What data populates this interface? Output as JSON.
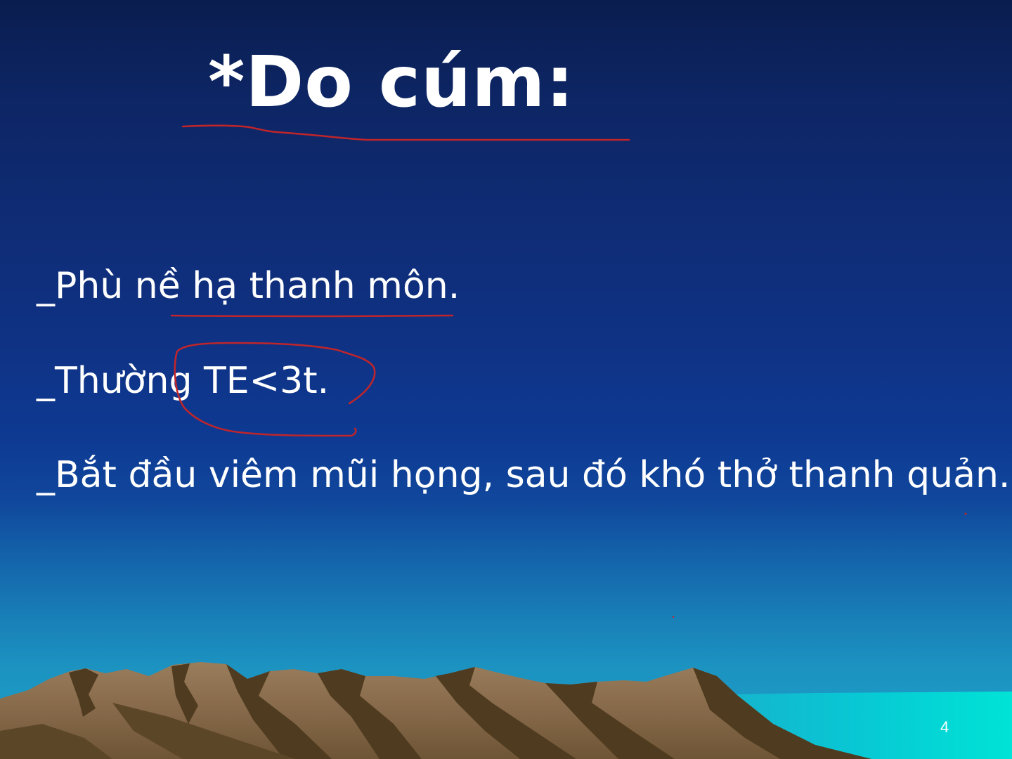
{
  "slide": {
    "title": "*Do cúm:",
    "bullets": [
      "_Phù nề hạ thanh môn.",
      "_Thường TE<3t.",
      "_Bắt đầu viêm mũi họng, sau đó khó thở thanh quản."
    ],
    "page_number": "4"
  },
  "colors": {
    "sky_top": "#0a1d4f",
    "sky_bottom": "#1b9ec6",
    "sea": "#00e0d8",
    "mountain_light": "#8a6e4e",
    "mountain_dark": "#4f3b1f",
    "annotation_ink": "#c0252a",
    "text": "#ffffff"
  },
  "icons": {
    "background": "mountain-landscape-icon"
  }
}
